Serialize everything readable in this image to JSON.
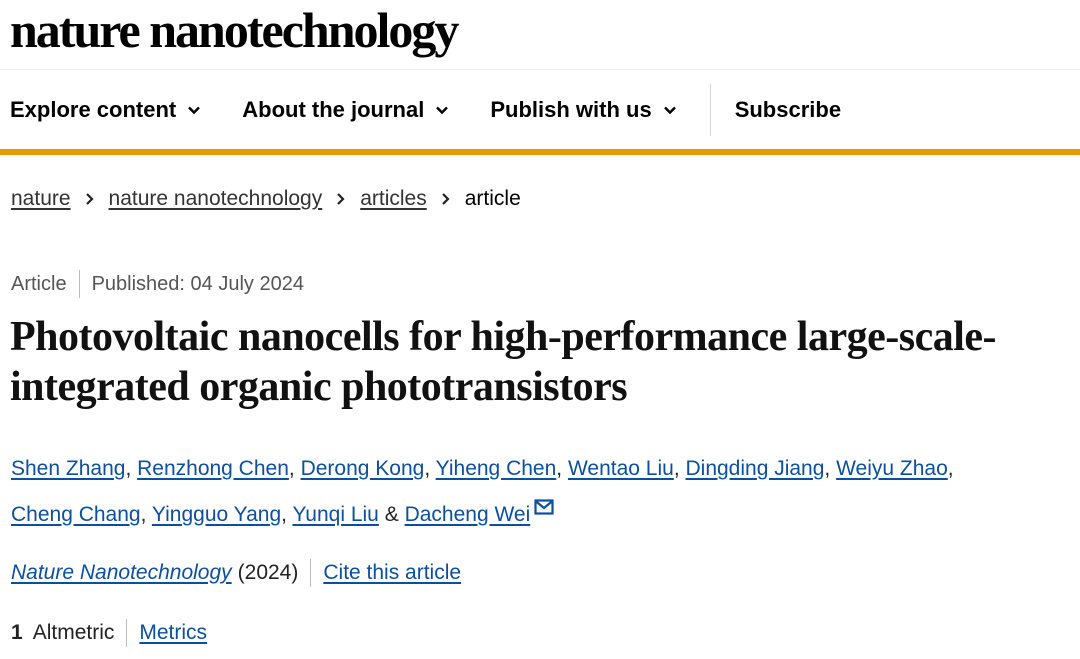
{
  "site": {
    "logo": "nature nanotechnology"
  },
  "nav": {
    "items": [
      {
        "label": "Explore content",
        "has_dropdown": true
      },
      {
        "label": "About the journal",
        "has_dropdown": true
      },
      {
        "label": "Publish with us",
        "has_dropdown": true
      }
    ],
    "subscribe": "Subscribe",
    "accent_color": "#e69b00"
  },
  "breadcrumb": {
    "links": [
      "nature",
      "nature nanotechnology",
      "articles"
    ],
    "current": "article"
  },
  "article": {
    "type": "Article",
    "published": "Published: 04 July 2024",
    "title": "Photovoltaic nanocells for high-performance large-scale-integrated organic phototransistors",
    "authors": [
      "Shen Zhang",
      "Renzhong Chen",
      "Derong Kong",
      "Yiheng Chen",
      "Wentao Liu",
      "Dingding Jiang",
      "Weiyu Zhao",
      "Cheng Chang",
      "Yingguo Yang",
      "Yunqi Liu",
      "Dacheng Wei"
    ],
    "author_joiner": "&",
    "journal": "Nature Nanotechnology",
    "year": "(2024)",
    "cite_label": "Cite this article",
    "altmetric_count": "1",
    "altmetric_label": "Altmetric",
    "metrics_label": "Metrics",
    "link_color": "#0c4f9e"
  }
}
